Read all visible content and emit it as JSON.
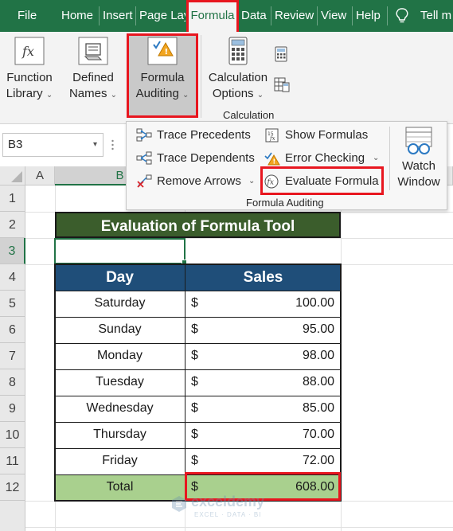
{
  "tabs": [
    {
      "label": "File",
      "active": false
    },
    {
      "label": "Home",
      "active": false
    },
    {
      "label": "Insert",
      "active": false
    },
    {
      "label": "Page Lay",
      "active": false
    },
    {
      "label": "Formula",
      "active": true
    },
    {
      "label": "Data",
      "active": false
    },
    {
      "label": "Review",
      "active": false
    },
    {
      "label": "View",
      "active": false
    },
    {
      "label": "Help",
      "active": false
    },
    {
      "label": "Tell m",
      "active": false
    }
  ],
  "ribbon": {
    "function_library": {
      "line1": "Function",
      "line2": "Library"
    },
    "defined_names": {
      "line1": "Defined",
      "line2": "Names"
    },
    "formula_auditing": {
      "line1": "Formula",
      "line2": "Auditing"
    },
    "calculation_options": {
      "line1": "Calculation",
      "line2": "Options"
    },
    "calculation_group": "Calculation"
  },
  "auditing_panel": {
    "trace_precedents": "Trace Precedents",
    "trace_dependents": "Trace Dependents",
    "remove_arrows": "Remove Arrows",
    "show_formulas": "Show Formulas",
    "error_checking": "Error Checking",
    "evaluate_formula": "Evaluate Formula",
    "watch_window": {
      "line1": "Watch",
      "line2": "Window"
    },
    "group_label": "Formula Auditing"
  },
  "name_box": "B3",
  "columns": [
    "A",
    "B"
  ],
  "rows": [
    "1",
    "2",
    "3",
    "4",
    "5",
    "6",
    "7",
    "8",
    "9",
    "10",
    "11",
    "12"
  ],
  "table": {
    "title": "Evaluation of Formula Tool",
    "headers": {
      "day": "Day",
      "sales": "Sales"
    },
    "currency": "$",
    "rows": [
      {
        "day": "Saturday",
        "sales": "100.00"
      },
      {
        "day": "Sunday",
        "sales": "95.00"
      },
      {
        "day": "Monday",
        "sales": "98.00"
      },
      {
        "day": "Tuesday",
        "sales": "88.00"
      },
      {
        "day": "Wednesday",
        "sales": "85.00"
      },
      {
        "day": "Thursday",
        "sales": "70.00"
      },
      {
        "day": "Friday",
        "sales": "72.00"
      }
    ],
    "total": {
      "label": "Total",
      "sales": "608.00"
    }
  },
  "watermark": {
    "name": "exceldemy",
    "tagline": "EXCEL · DATA · BI"
  },
  "colors": {
    "excel_green": "#217346",
    "highlight_red": "#e8161f",
    "title_bg": "#3b5d2c",
    "header_bg": "#1f4e79",
    "total_bg": "#a9d08e"
  }
}
